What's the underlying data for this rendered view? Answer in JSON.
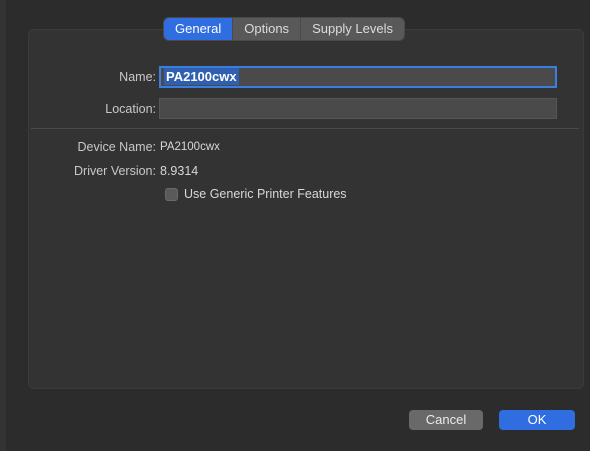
{
  "tabs": [
    {
      "label": "General",
      "active": true
    },
    {
      "label": "Options",
      "active": false
    },
    {
      "label": "Supply Levels",
      "active": false
    }
  ],
  "form": {
    "name_label": "Name:",
    "name_value": "PA2100cwx",
    "location_label": "Location:",
    "location_value": ""
  },
  "info": {
    "device_name_label": "Device Name:",
    "device_name_value": "PA2100cwx",
    "driver_version_label": "Driver Version:",
    "driver_version_value": "8.9314"
  },
  "checkbox": {
    "label": "Use Generic Printer Features",
    "checked": false
  },
  "buttons": {
    "cancel_label": "Cancel",
    "ok_label": "OK"
  },
  "colors": {
    "accent": "#2f6de0",
    "background": "#2b2b2b",
    "panel": "#333333"
  }
}
